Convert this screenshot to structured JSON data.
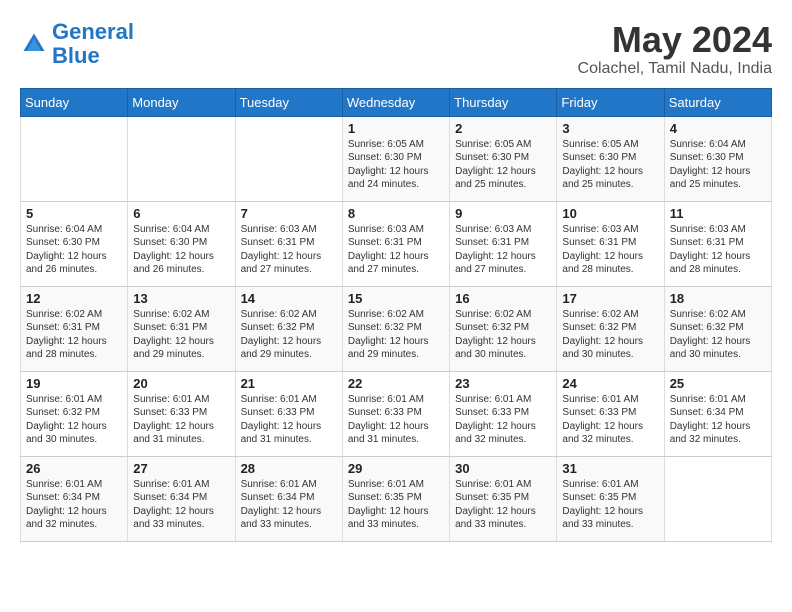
{
  "header": {
    "logo_line1": "General",
    "logo_line2": "Blue",
    "month_year": "May 2024",
    "location": "Colachel, Tamil Nadu, India"
  },
  "days_of_week": [
    "Sunday",
    "Monday",
    "Tuesday",
    "Wednesday",
    "Thursday",
    "Friday",
    "Saturday"
  ],
  "weeks": [
    [
      {
        "day": "",
        "info": ""
      },
      {
        "day": "",
        "info": ""
      },
      {
        "day": "",
        "info": ""
      },
      {
        "day": "1",
        "info": "Sunrise: 6:05 AM\nSunset: 6:30 PM\nDaylight: 12 hours\nand 24 minutes."
      },
      {
        "day": "2",
        "info": "Sunrise: 6:05 AM\nSunset: 6:30 PM\nDaylight: 12 hours\nand 25 minutes."
      },
      {
        "day": "3",
        "info": "Sunrise: 6:05 AM\nSunset: 6:30 PM\nDaylight: 12 hours\nand 25 minutes."
      },
      {
        "day": "4",
        "info": "Sunrise: 6:04 AM\nSunset: 6:30 PM\nDaylight: 12 hours\nand 25 minutes."
      }
    ],
    [
      {
        "day": "5",
        "info": "Sunrise: 6:04 AM\nSunset: 6:30 PM\nDaylight: 12 hours\nand 26 minutes."
      },
      {
        "day": "6",
        "info": "Sunrise: 6:04 AM\nSunset: 6:30 PM\nDaylight: 12 hours\nand 26 minutes."
      },
      {
        "day": "7",
        "info": "Sunrise: 6:03 AM\nSunset: 6:31 PM\nDaylight: 12 hours\nand 27 minutes."
      },
      {
        "day": "8",
        "info": "Sunrise: 6:03 AM\nSunset: 6:31 PM\nDaylight: 12 hours\nand 27 minutes."
      },
      {
        "day": "9",
        "info": "Sunrise: 6:03 AM\nSunset: 6:31 PM\nDaylight: 12 hours\nand 27 minutes."
      },
      {
        "day": "10",
        "info": "Sunrise: 6:03 AM\nSunset: 6:31 PM\nDaylight: 12 hours\nand 28 minutes."
      },
      {
        "day": "11",
        "info": "Sunrise: 6:03 AM\nSunset: 6:31 PM\nDaylight: 12 hours\nand 28 minutes."
      }
    ],
    [
      {
        "day": "12",
        "info": "Sunrise: 6:02 AM\nSunset: 6:31 PM\nDaylight: 12 hours\nand 28 minutes."
      },
      {
        "day": "13",
        "info": "Sunrise: 6:02 AM\nSunset: 6:31 PM\nDaylight: 12 hours\nand 29 minutes."
      },
      {
        "day": "14",
        "info": "Sunrise: 6:02 AM\nSunset: 6:32 PM\nDaylight: 12 hours\nand 29 minutes."
      },
      {
        "day": "15",
        "info": "Sunrise: 6:02 AM\nSunset: 6:32 PM\nDaylight: 12 hours\nand 29 minutes."
      },
      {
        "day": "16",
        "info": "Sunrise: 6:02 AM\nSunset: 6:32 PM\nDaylight: 12 hours\nand 30 minutes."
      },
      {
        "day": "17",
        "info": "Sunrise: 6:02 AM\nSunset: 6:32 PM\nDaylight: 12 hours\nand 30 minutes."
      },
      {
        "day": "18",
        "info": "Sunrise: 6:02 AM\nSunset: 6:32 PM\nDaylight: 12 hours\nand 30 minutes."
      }
    ],
    [
      {
        "day": "19",
        "info": "Sunrise: 6:01 AM\nSunset: 6:32 PM\nDaylight: 12 hours\nand 30 minutes."
      },
      {
        "day": "20",
        "info": "Sunrise: 6:01 AM\nSunset: 6:33 PM\nDaylight: 12 hours\nand 31 minutes."
      },
      {
        "day": "21",
        "info": "Sunrise: 6:01 AM\nSunset: 6:33 PM\nDaylight: 12 hours\nand 31 minutes."
      },
      {
        "day": "22",
        "info": "Sunrise: 6:01 AM\nSunset: 6:33 PM\nDaylight: 12 hours\nand 31 minutes."
      },
      {
        "day": "23",
        "info": "Sunrise: 6:01 AM\nSunset: 6:33 PM\nDaylight: 12 hours\nand 32 minutes."
      },
      {
        "day": "24",
        "info": "Sunrise: 6:01 AM\nSunset: 6:33 PM\nDaylight: 12 hours\nand 32 minutes."
      },
      {
        "day": "25",
        "info": "Sunrise: 6:01 AM\nSunset: 6:34 PM\nDaylight: 12 hours\nand 32 minutes."
      }
    ],
    [
      {
        "day": "26",
        "info": "Sunrise: 6:01 AM\nSunset: 6:34 PM\nDaylight: 12 hours\nand 32 minutes."
      },
      {
        "day": "27",
        "info": "Sunrise: 6:01 AM\nSunset: 6:34 PM\nDaylight: 12 hours\nand 33 minutes."
      },
      {
        "day": "28",
        "info": "Sunrise: 6:01 AM\nSunset: 6:34 PM\nDaylight: 12 hours\nand 33 minutes."
      },
      {
        "day": "29",
        "info": "Sunrise: 6:01 AM\nSunset: 6:35 PM\nDaylight: 12 hours\nand 33 minutes."
      },
      {
        "day": "30",
        "info": "Sunrise: 6:01 AM\nSunset: 6:35 PM\nDaylight: 12 hours\nand 33 minutes."
      },
      {
        "day": "31",
        "info": "Sunrise: 6:01 AM\nSunset: 6:35 PM\nDaylight: 12 hours\nand 33 minutes."
      },
      {
        "day": "",
        "info": ""
      }
    ]
  ]
}
